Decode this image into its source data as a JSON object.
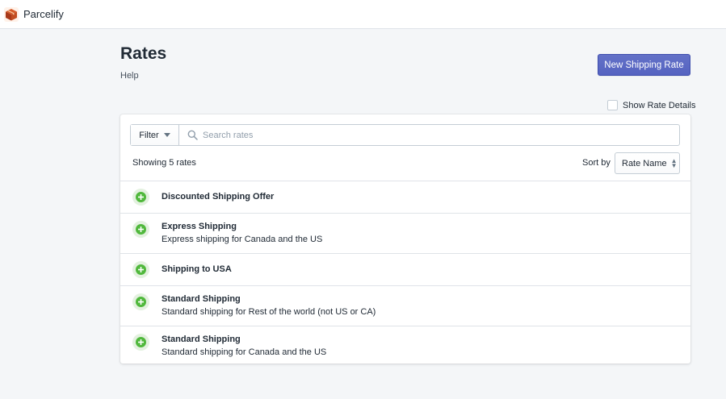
{
  "app": {
    "name": "Parcelify",
    "logo_icon": "package-box-icon",
    "logo_color": "#b5441a"
  },
  "page": {
    "title": "Rates",
    "help_label": "Help",
    "primary_action_label": "New Shipping Rate",
    "show_details_label": "Show Rate Details",
    "show_details_checked": false
  },
  "filters": {
    "filter_label": "Filter",
    "search_placeholder": "Search rates",
    "search_value": ""
  },
  "results": {
    "summary": "Showing 5 rates",
    "sort_label": "Sort by",
    "sort_value": "Rate Name"
  },
  "rates": [
    {
      "name": "Discounted Shipping Offer",
      "description": ""
    },
    {
      "name": "Express Shipping",
      "description": "Express shipping for Canada and the US"
    },
    {
      "name": "Shipping to USA",
      "description": ""
    },
    {
      "name": "Standard Shipping",
      "description": "Standard shipping for Rest of the world (not US or CA)"
    },
    {
      "name": "Standard Shipping",
      "description": "Standard shipping for Canada and the US"
    }
  ],
  "colors": {
    "primary": "#5c6ac4",
    "status_active": "#50b83c",
    "status_bg": "#e3f1df"
  }
}
